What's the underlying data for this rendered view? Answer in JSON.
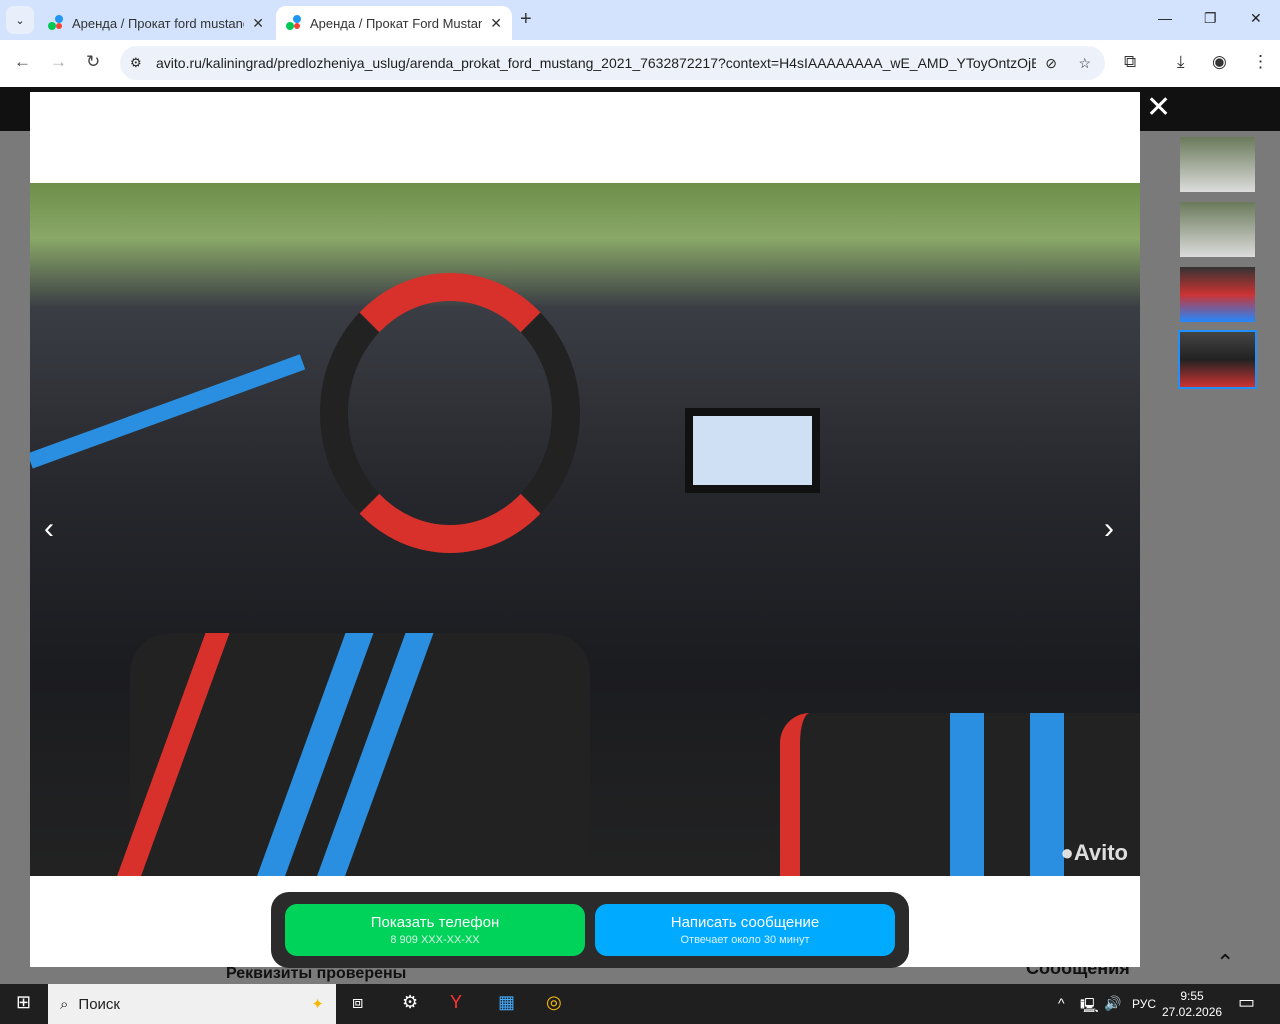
{
  "browser": {
    "tabs": [
      {
        "title": "Аренда / Прокат ford mustang",
        "active": false
      },
      {
        "title": "Аренда / Прокат Ford Mustang",
        "active": true
      }
    ],
    "url": "avito.ru/kaliningrad/predlozheniya_uslug/arenda_prokat_ford_mustang_2021_7632872217?context=H4sIAAAAAAAA_wE_AMD_YToyOntzOjE..."
  },
  "gallery": {
    "thumbnail_count": 4,
    "selected_index": 3,
    "watermark": "Avito"
  },
  "actions": {
    "phone": {
      "label": "Показать телефон",
      "sub": "8 909 XXX-XX-XX",
      "color": "#00d35a"
    },
    "message": {
      "label": "Написать сообщение",
      "sub": "Отвечает около 30 минут",
      "color": "#00aaff"
    }
  },
  "page_behind": {
    "verified": "Реквизиты проверены",
    "messages": "Сообщения"
  },
  "taskbar": {
    "search": "Поиск",
    "lang": "РУС",
    "time": "9:55",
    "date": "27.02.2026"
  }
}
